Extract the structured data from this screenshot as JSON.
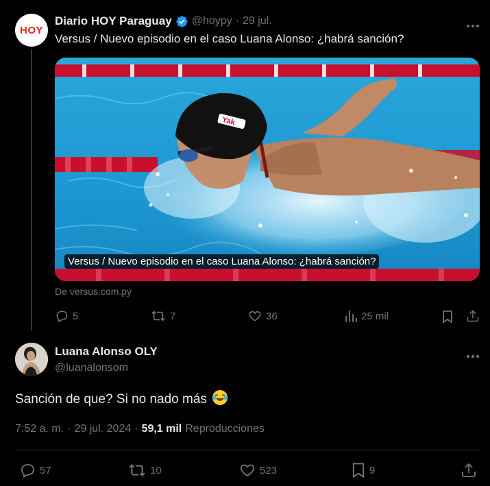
{
  "tweet1": {
    "author_name": "Diario HOY Paraguay",
    "handle": "@hoypy",
    "separator": "·",
    "date": "29 jul.",
    "avatar_text": "HOY",
    "text": "Versus / Nuevo episodio en el caso Luana Alonso: ¿habrá sanción?",
    "card": {
      "caption": "Versus / Nuevo episodio en el caso Luana Alonso: ¿habrá sanción?",
      "source": "De versus.com.py",
      "cap_brand_text": "Yak"
    },
    "actions": {
      "replies": "5",
      "reposts": "7",
      "likes": "36",
      "views": "25 mil"
    }
  },
  "tweet2": {
    "author_name": "Luana Alonso OLY",
    "handle": "@luanalonsom",
    "text": "Sanción de que? Si no nado más",
    "emoji": "😂",
    "time": "7:52 a. m.",
    "separator": "·",
    "date": "29 jul. 2024",
    "views_count": "59,1 mil",
    "views_label": "Reproducciones",
    "actions": {
      "replies": "57",
      "reposts": "10",
      "likes": "523",
      "bookmarks": "9"
    }
  },
  "colors": {
    "background": "#000000",
    "text": "#e7e9ea",
    "muted": "#71767b",
    "verified": "#1d9bf0",
    "hoy_red": "#e2231a",
    "divider": "#2f3336"
  }
}
